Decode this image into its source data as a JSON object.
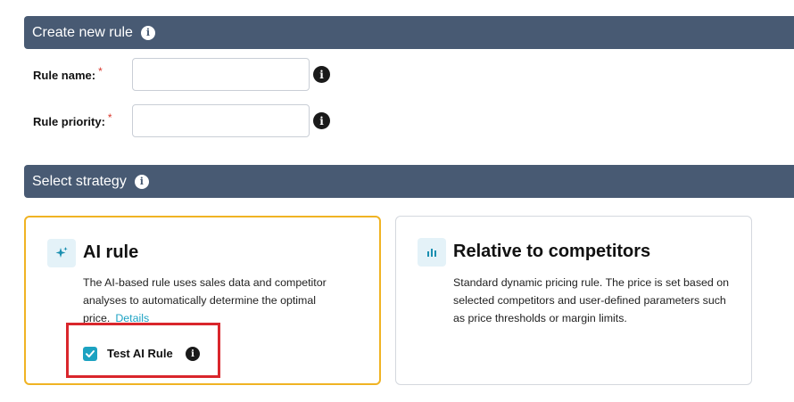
{
  "create_section": {
    "title": "Create new rule",
    "info_icon": "info-icon"
  },
  "form": {
    "rule_name_label": "Rule name:",
    "rule_priority_label": "Rule priority:",
    "required_mark": "*",
    "rule_name_value": "",
    "rule_priority_value": ""
  },
  "strategy_section": {
    "title": "Select strategy",
    "info_icon": "info-icon"
  },
  "strategies": {
    "ai": {
      "title": "AI rule",
      "icon": "sparkle-icon",
      "description": "The AI-based rule uses sales data and competitor analyses to automatically determine the optimal price.",
      "details_link": "Details",
      "selected": true,
      "checkbox_label": "Test AI Rule",
      "checkbox_checked": true
    },
    "relative": {
      "title": "Relative to competitors",
      "icon": "bar-chart-icon",
      "description": "Standard dynamic pricing rule. The price is set based on selected competitors and user-defined parameters such as price thresholds or margin limits."
    }
  },
  "colors": {
    "header_bg": "#485a73",
    "selected_border": "#f0b323",
    "accent": "#1ca2c1",
    "highlight": "#d9262c",
    "required": "#d9362b"
  }
}
